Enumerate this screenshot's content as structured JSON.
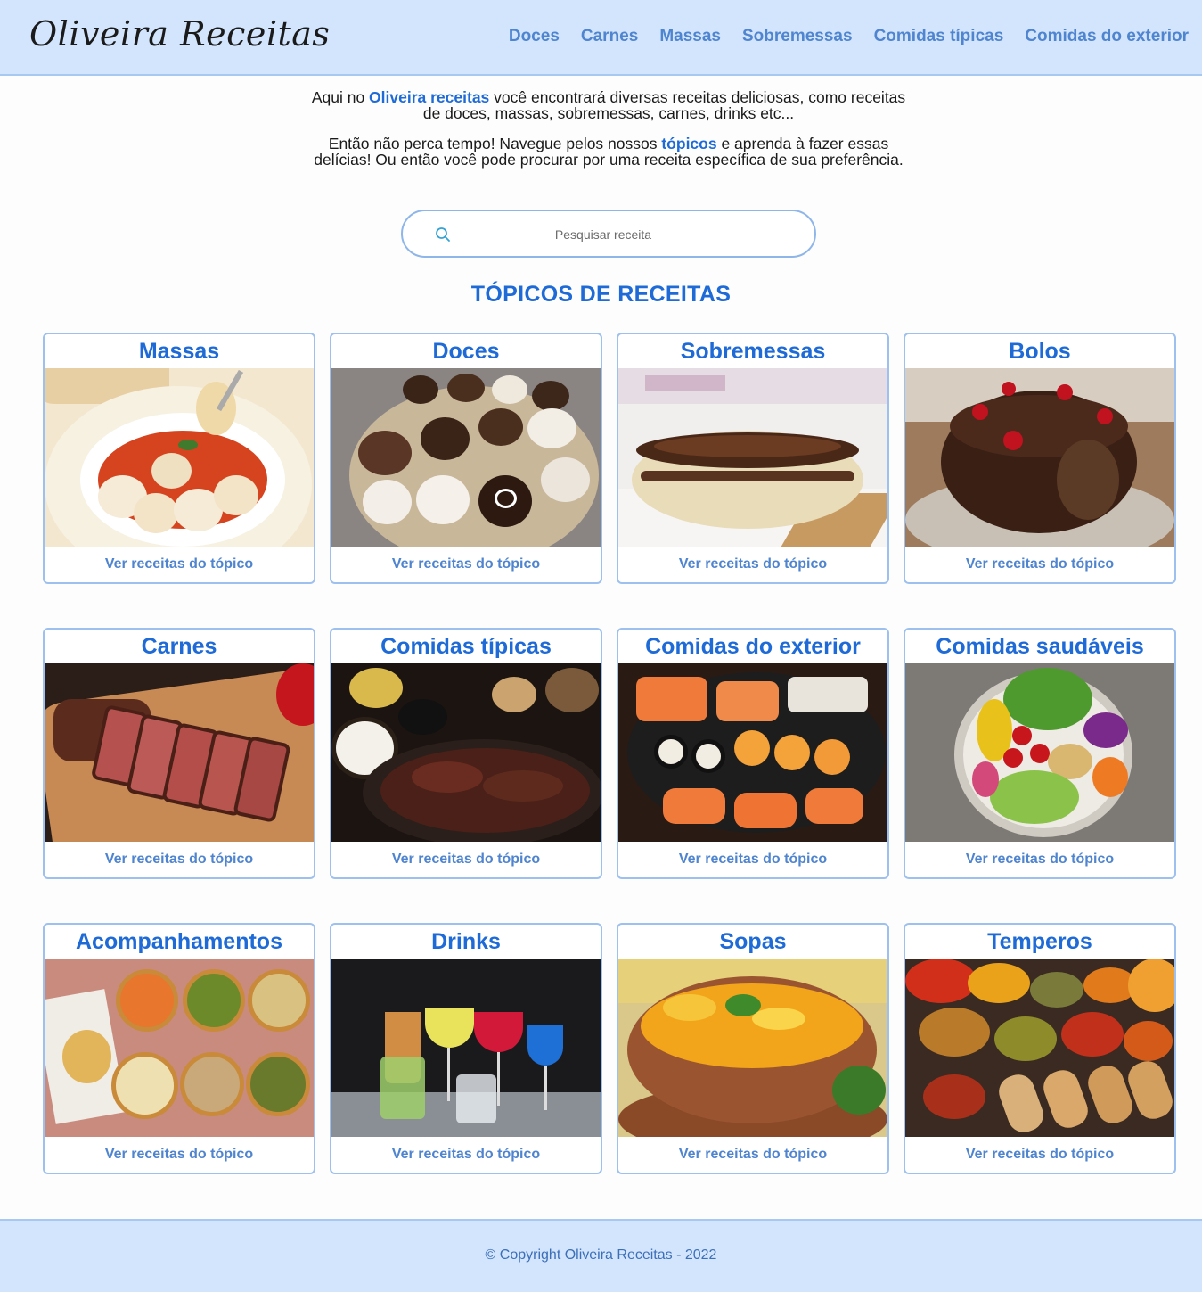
{
  "header": {
    "logo": "Oliveira Receitas",
    "nav": [
      "Doces",
      "Carnes",
      "Massas",
      "Sobremessas",
      "Comidas típicas",
      "Comidas do exterior"
    ]
  },
  "intro": {
    "p1_pre": "Aqui no ",
    "p1_hl": "Oliveira receitas",
    "p1_post": " você encontrará diversas receitas deliciosas, como receitas de doces, massas, sobremessas, carnes, drinks etc...",
    "p2_pre": "Então não perca tempo! Navegue pelos nossos ",
    "p2_hl": "tópicos",
    "p2_post": " e aprenda à fazer essas delícias! Ou então você pode procurar por uma receita específica de sua preferência."
  },
  "search": {
    "placeholder": "Pesquisar receita",
    "icon": "search-icon"
  },
  "section_title": "TÓPICOS DE RECEITAS",
  "card_link_label": "Ver receitas do tópico",
  "cards": [
    {
      "title": "Massas"
    },
    {
      "title": "Doces"
    },
    {
      "title": "Sobremessas"
    },
    {
      "title": "Bolos"
    },
    {
      "title": "Carnes"
    },
    {
      "title": "Comidas típicas"
    },
    {
      "title": "Comidas do exterior"
    },
    {
      "title": "Comidas saudáveis"
    },
    {
      "title": "Acompanhamentos"
    },
    {
      "title": "Drinks"
    },
    {
      "title": "Sopas"
    },
    {
      "title": "Temperos"
    }
  ],
  "footer": {
    "copyright": "© Copyright Oliveira Receitas - 2022"
  },
  "colors": {
    "header_bg": "#d2e5fd",
    "accent": "#1e6ad6",
    "link": "#4f84cf",
    "border": "#9dc0ee"
  }
}
